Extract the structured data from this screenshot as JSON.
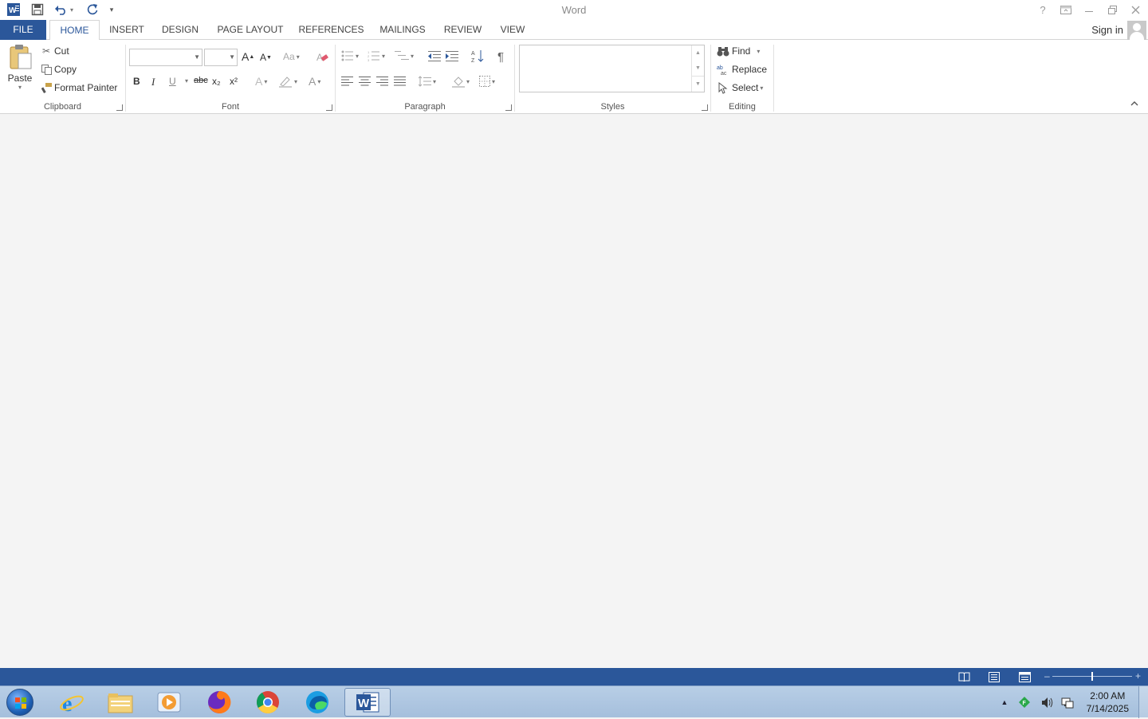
{
  "window": {
    "title": "Word"
  },
  "qat": {
    "customize_glyph": "▾"
  },
  "tabs": [
    {
      "label": "FILE"
    },
    {
      "label": "HOME"
    },
    {
      "label": "INSERT"
    },
    {
      "label": "DESIGN"
    },
    {
      "label": "PAGE LAYOUT"
    },
    {
      "label": "REFERENCES"
    },
    {
      "label": "MAILINGS"
    },
    {
      "label": "REVIEW"
    },
    {
      "label": "VIEW"
    }
  ],
  "account": {
    "sign_in": "Sign in"
  },
  "clipboard": {
    "paste": "Paste",
    "cut": "Cut",
    "copy": "Copy",
    "format_painter": "Format Painter",
    "label": "Clipboard"
  },
  "font": {
    "label": "Font",
    "bold": "B",
    "italic": "I",
    "underline": "U",
    "strike": "abc",
    "subscript": "x₂",
    "superscript": "x²",
    "grow": "A",
    "shrink": "A",
    "case": "Aa",
    "font_color": "A",
    "text_effects": "A"
  },
  "paragraph": {
    "label": "Paragraph",
    "pilcrow": "¶"
  },
  "styles": {
    "label": "Styles"
  },
  "editing": {
    "label": "Editing",
    "find": "Find",
    "replace": "Replace",
    "select": "Select"
  },
  "taskbar": {
    "time": "2:00 AM",
    "date": "7/14/2025"
  },
  "colors": {
    "brand": "#2b579a",
    "file_tab": "#2b579a",
    "status_bar": "#2b579a"
  }
}
